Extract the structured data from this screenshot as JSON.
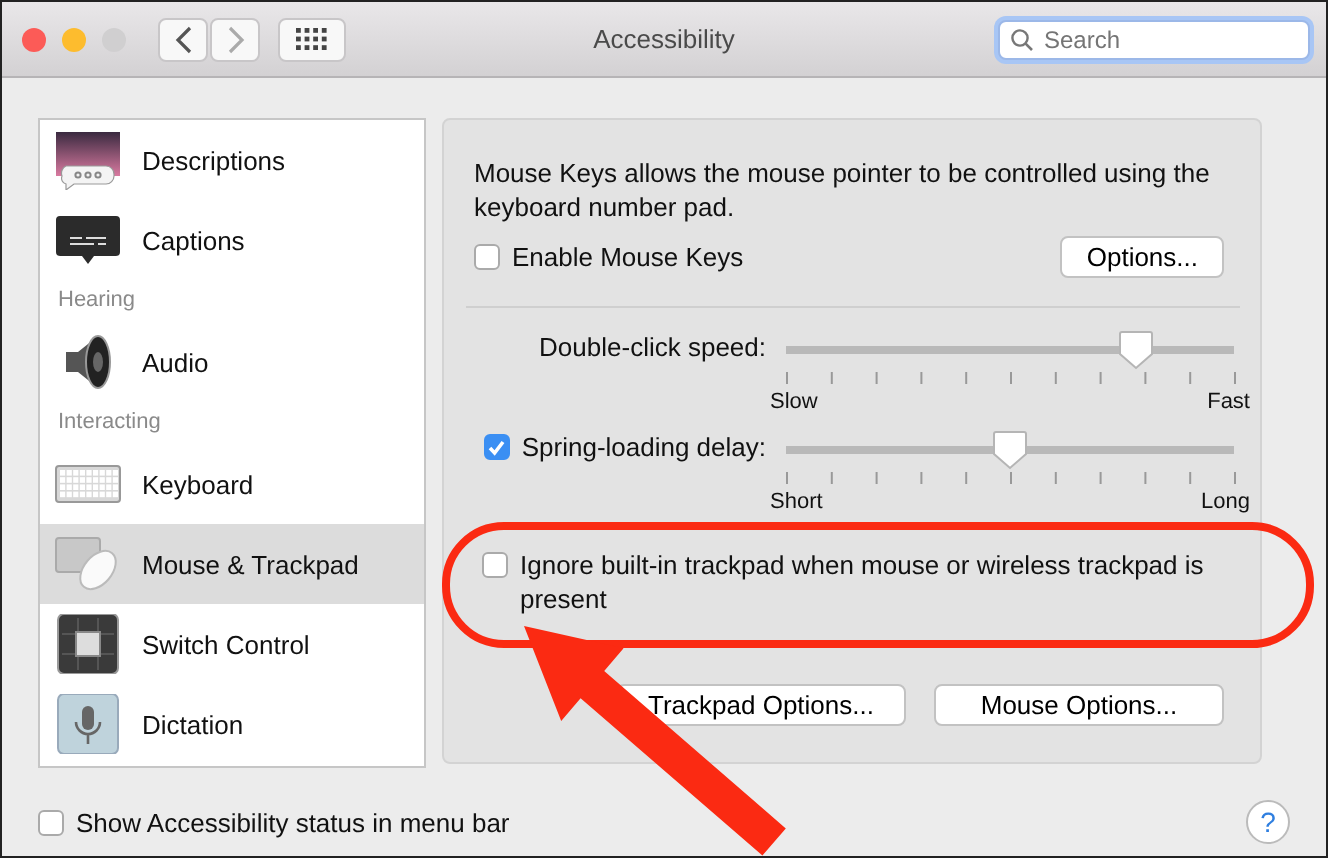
{
  "window": {
    "title": "Accessibility"
  },
  "search": {
    "placeholder": "Search"
  },
  "sidebar": {
    "items": [
      {
        "kind": "item",
        "label": "Descriptions",
        "selected": false
      },
      {
        "kind": "item",
        "label": "Captions",
        "selected": false
      },
      {
        "kind": "header",
        "label": "Hearing"
      },
      {
        "kind": "item",
        "label": "Audio",
        "selected": false
      },
      {
        "kind": "header",
        "label": "Interacting"
      },
      {
        "kind": "item",
        "label": "Keyboard",
        "selected": false
      },
      {
        "kind": "item",
        "label": "Mouse & Trackpad",
        "selected": true
      },
      {
        "kind": "item",
        "label": "Switch Control",
        "selected": false
      },
      {
        "kind": "item",
        "label": "Dictation",
        "selected": false
      }
    ]
  },
  "panel": {
    "description": "Mouse Keys allows the mouse pointer to be controlled using the keyboard number pad.",
    "enable_mouse_keys": {
      "label": "Enable Mouse Keys",
      "checked": false
    },
    "options_button": "Options...",
    "sliders": [
      {
        "kind": "plain",
        "label": "Double-click speed:",
        "level": 0.78,
        "min_label": "Slow",
        "max_label": "Fast"
      },
      {
        "kind": "checkbox",
        "label": "Spring-loading delay:",
        "checked": true,
        "level": 0.5,
        "min_label": "Short",
        "max_label": "Long"
      }
    ],
    "ignore_trackpad": {
      "label": "Ignore built-in trackpad when mouse or wireless trackpad is present",
      "checked": false
    },
    "buttons": [
      "Trackpad Options...",
      "Mouse Options..."
    ]
  },
  "footer": {
    "show_status": {
      "label": "Show Accessibility status in menu bar",
      "checked": false
    },
    "help_button": "?"
  }
}
